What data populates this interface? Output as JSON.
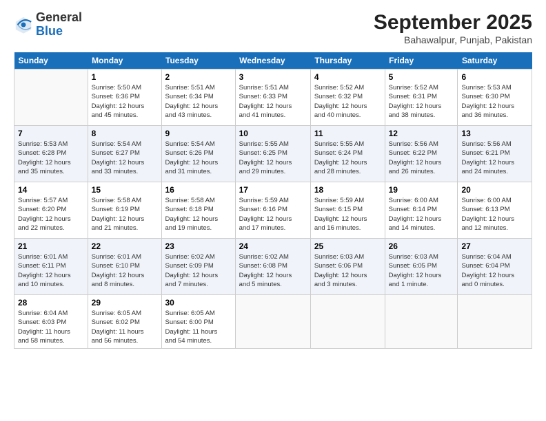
{
  "logo": {
    "general": "General",
    "blue": "Blue"
  },
  "title": "September 2025",
  "subtitle": "Bahawalpur, Punjab, Pakistan",
  "days_header": [
    "Sunday",
    "Monday",
    "Tuesday",
    "Wednesday",
    "Thursday",
    "Friday",
    "Saturday"
  ],
  "weeks": [
    [
      {
        "day": "",
        "info": ""
      },
      {
        "day": "1",
        "info": "Sunrise: 5:50 AM\nSunset: 6:36 PM\nDaylight: 12 hours\nand 45 minutes."
      },
      {
        "day": "2",
        "info": "Sunrise: 5:51 AM\nSunset: 6:34 PM\nDaylight: 12 hours\nand 43 minutes."
      },
      {
        "day": "3",
        "info": "Sunrise: 5:51 AM\nSunset: 6:33 PM\nDaylight: 12 hours\nand 41 minutes."
      },
      {
        "day": "4",
        "info": "Sunrise: 5:52 AM\nSunset: 6:32 PM\nDaylight: 12 hours\nand 40 minutes."
      },
      {
        "day": "5",
        "info": "Sunrise: 5:52 AM\nSunset: 6:31 PM\nDaylight: 12 hours\nand 38 minutes."
      },
      {
        "day": "6",
        "info": "Sunrise: 5:53 AM\nSunset: 6:30 PM\nDaylight: 12 hours\nand 36 minutes."
      }
    ],
    [
      {
        "day": "7",
        "info": "Sunrise: 5:53 AM\nSunset: 6:28 PM\nDaylight: 12 hours\nand 35 minutes."
      },
      {
        "day": "8",
        "info": "Sunrise: 5:54 AM\nSunset: 6:27 PM\nDaylight: 12 hours\nand 33 minutes."
      },
      {
        "day": "9",
        "info": "Sunrise: 5:54 AM\nSunset: 6:26 PM\nDaylight: 12 hours\nand 31 minutes."
      },
      {
        "day": "10",
        "info": "Sunrise: 5:55 AM\nSunset: 6:25 PM\nDaylight: 12 hours\nand 29 minutes."
      },
      {
        "day": "11",
        "info": "Sunrise: 5:55 AM\nSunset: 6:24 PM\nDaylight: 12 hours\nand 28 minutes."
      },
      {
        "day": "12",
        "info": "Sunrise: 5:56 AM\nSunset: 6:22 PM\nDaylight: 12 hours\nand 26 minutes."
      },
      {
        "day": "13",
        "info": "Sunrise: 5:56 AM\nSunset: 6:21 PM\nDaylight: 12 hours\nand 24 minutes."
      }
    ],
    [
      {
        "day": "14",
        "info": "Sunrise: 5:57 AM\nSunset: 6:20 PM\nDaylight: 12 hours\nand 22 minutes."
      },
      {
        "day": "15",
        "info": "Sunrise: 5:58 AM\nSunset: 6:19 PM\nDaylight: 12 hours\nand 21 minutes."
      },
      {
        "day": "16",
        "info": "Sunrise: 5:58 AM\nSunset: 6:18 PM\nDaylight: 12 hours\nand 19 minutes."
      },
      {
        "day": "17",
        "info": "Sunrise: 5:59 AM\nSunset: 6:16 PM\nDaylight: 12 hours\nand 17 minutes."
      },
      {
        "day": "18",
        "info": "Sunrise: 5:59 AM\nSunset: 6:15 PM\nDaylight: 12 hours\nand 16 minutes."
      },
      {
        "day": "19",
        "info": "Sunrise: 6:00 AM\nSunset: 6:14 PM\nDaylight: 12 hours\nand 14 minutes."
      },
      {
        "day": "20",
        "info": "Sunrise: 6:00 AM\nSunset: 6:13 PM\nDaylight: 12 hours\nand 12 minutes."
      }
    ],
    [
      {
        "day": "21",
        "info": "Sunrise: 6:01 AM\nSunset: 6:11 PM\nDaylight: 12 hours\nand 10 minutes."
      },
      {
        "day": "22",
        "info": "Sunrise: 6:01 AM\nSunset: 6:10 PM\nDaylight: 12 hours\nand 8 minutes."
      },
      {
        "day": "23",
        "info": "Sunrise: 6:02 AM\nSunset: 6:09 PM\nDaylight: 12 hours\nand 7 minutes."
      },
      {
        "day": "24",
        "info": "Sunrise: 6:02 AM\nSunset: 6:08 PM\nDaylight: 12 hours\nand 5 minutes."
      },
      {
        "day": "25",
        "info": "Sunrise: 6:03 AM\nSunset: 6:06 PM\nDaylight: 12 hours\nand 3 minutes."
      },
      {
        "day": "26",
        "info": "Sunrise: 6:03 AM\nSunset: 6:05 PM\nDaylight: 12 hours\nand 1 minute."
      },
      {
        "day": "27",
        "info": "Sunrise: 6:04 AM\nSunset: 6:04 PM\nDaylight: 12 hours\nand 0 minutes."
      }
    ],
    [
      {
        "day": "28",
        "info": "Sunrise: 6:04 AM\nSunset: 6:03 PM\nDaylight: 11 hours\nand 58 minutes."
      },
      {
        "day": "29",
        "info": "Sunrise: 6:05 AM\nSunset: 6:02 PM\nDaylight: 11 hours\nand 56 minutes."
      },
      {
        "day": "30",
        "info": "Sunrise: 6:05 AM\nSunset: 6:00 PM\nDaylight: 11 hours\nand 54 minutes."
      },
      {
        "day": "",
        "info": ""
      },
      {
        "day": "",
        "info": ""
      },
      {
        "day": "",
        "info": ""
      },
      {
        "day": "",
        "info": ""
      }
    ]
  ]
}
